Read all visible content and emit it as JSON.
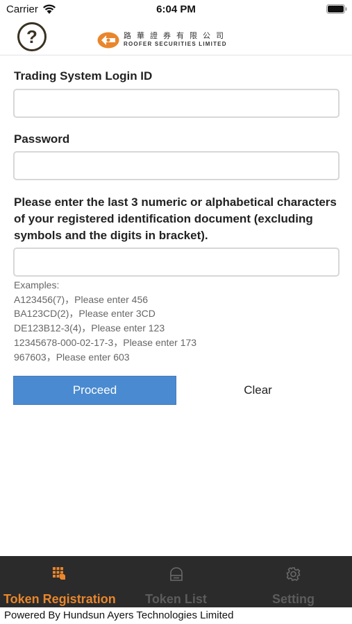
{
  "status_bar": {
    "carrier": "Carrier",
    "time": "6:04 PM"
  },
  "header": {
    "help_symbol": "?",
    "logo_chinese": "路華證券有限公司",
    "logo_english": "ROOFER SECURITIES LIMITED",
    "brand_color": "#e9862c"
  },
  "form": {
    "login_id_label": "Trading System Login ID",
    "login_id_value": "",
    "password_label": "Password",
    "password_value": "",
    "id_doc_instruction": "Please enter the last 3 numeric or alphabetical characters of your registered identification document (excluding symbols and the digits in bracket).",
    "id_doc_value": "",
    "examples_title": "Examples:",
    "examples": [
      "A123456(7)，Please enter 456",
      "BA123CD(2)，Please enter 3CD",
      "DE123B12-3(4)，Please enter 123",
      "12345678-000-02-17-3，Please enter 173",
      "967603，Please enter 603"
    ],
    "proceed_label": "Proceed",
    "clear_label": "Clear",
    "accent_color": "#4a8ad0"
  },
  "tab_bar": {
    "tabs": [
      {
        "label": "Token Registration",
        "icon": "token-registration-icon",
        "active": true
      },
      {
        "label": "Token List",
        "icon": "token-list-icon",
        "active": false
      },
      {
        "label": "Setting",
        "icon": "gear-icon",
        "active": false
      }
    ],
    "active_color": "#e9862c",
    "inactive_color": "#5c5c5c",
    "background": "#2b2b2b"
  },
  "footer": {
    "text": "Powered By Hundsun Ayers Technologies Limited"
  }
}
